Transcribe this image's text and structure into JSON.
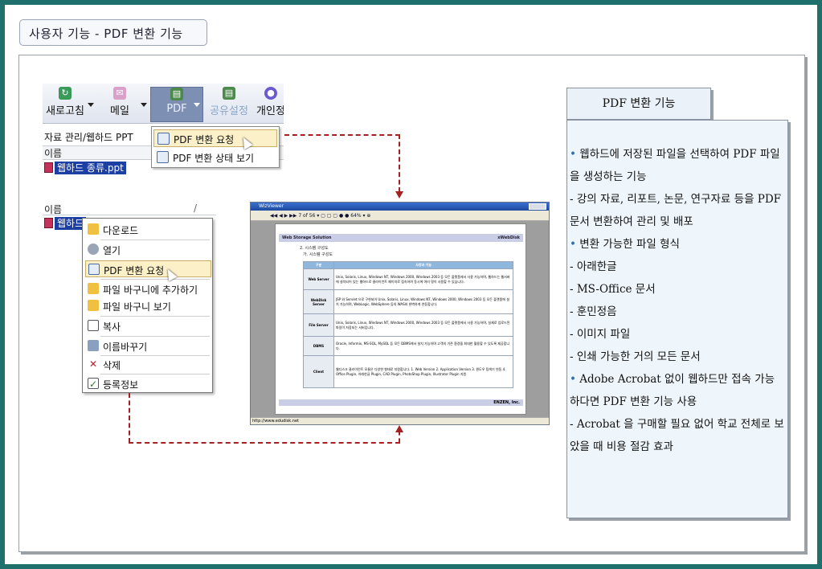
{
  "slide_title": "사용자 기능 - PDF 변환 기능",
  "toolbar": {
    "refresh": "새로고침",
    "mail": "메일",
    "pdf": "PDF",
    "share": "공유설정",
    "personal": "개인정"
  },
  "breadcrumb": "자료 관리/웹하드 PPT",
  "name_column": "이름",
  "selected_file": "웹하드 종류.ppt",
  "pdf_menu": {
    "request": "PDF 변환 요청",
    "status": "PDF 변환 상태 보기"
  },
  "list_header": "이름",
  "list_file": "웹하드",
  "context_menu": [
    "다운로드",
    "열기",
    "PDF 변환 요청",
    "파일 바구니에 추가하기",
    "파일 바구니 보기",
    "복사",
    "이름바꾸기",
    "삭제",
    "등록정보"
  ],
  "viewer": {
    "title": "WizViewer",
    "page_indicator": "7 of 56",
    "zoom": "64%",
    "doc_header_left": "Web Storage Solution",
    "doc_header_right": "xWebDisk",
    "section": "2. 시스템 구성도",
    "subsection": "가. 시스템 구성도",
    "col_left": "구분",
    "col_right": "사양과 기능",
    "rows": [
      {
        "k": "Web Server",
        "v": "Unix, Solaris, Linux, Windows NT, Windows 2000, Windows 2003 등 모든 플랫폼에서 사용 가능하며, 웹하드는 웹서버에 설치되어 있는 웹하드로 클라이언트 페이지로 접속하여 동시에 여러 명이 사용할 수 있습니다."
      },
      {
        "k": "WebDisk Server",
        "v": "JSP 와 Servlet 으로 구현되어 Unix, Solaris, Linux, Windows NT, Windows 2000, Windows 2003 등 모든 플랫폼에 설치 가능하며, WebLogic, WebSphere 등의 WAS와 완벽하게 연동합니다."
      },
      {
        "k": "File Server",
        "v": "Unix, Solaris, Linux, Windows NT, Windows 2000, Windows 2003 등 모든 플랫폼에서 사용 가능하며, 실제로 업로드된 파일이 저장되는 서버입니다."
      },
      {
        "k": "DBMS",
        "v": "Oracle, Informix, MS-SQL, MySQL 등 모든 DBMS에서 설치 가능하며 고객의 기존 환경을 최대한 활용할 수 있도록 제공합니다."
      },
      {
        "k": "Client",
        "v": "웹디스크 클라이언트 모듈은 다양한 형태로 지원합니다. 1. Web Version 2. Application Version 3. 윈도우 탐색기 연동 4. Office Plugin, 아래한글 Plugin, CAD Plugin, PhotoShop Plugin, Illustrator Plugin 지원"
      }
    ],
    "doc_footer": "ENZEN, Inc.",
    "status_url": "http://www.edudisk.net"
  },
  "info": {
    "title": "PDF 변환 기능",
    "lines": [
      {
        "bullet": "•",
        "text": " 웹하드에 저장된 파일을 선택하여 PDF 파일을 생성하는 기능"
      },
      {
        "bullet": "",
        "text": "  - 강의 자료, 리포트, 논문, 연구자료 등을 PDF 문서 변환하여 관리 및 배포"
      },
      {
        "bullet": "•",
        "text": " 변환 가능한 파일 형식"
      },
      {
        "bullet": "",
        "text": "  - 아래한글"
      },
      {
        "bullet": "",
        "text": "  - MS-Office 문서"
      },
      {
        "bullet": "",
        "text": "  - 훈민정음"
      },
      {
        "bullet": "",
        "text": "  - 이미지 파일"
      },
      {
        "bullet": "",
        "text": "  - 인쇄 가능한 거의 모든 문서"
      },
      {
        "bullet": "•",
        "text": " Adobe Acrobat 없이 웹하드만 접속 가능하다면 PDF 변환 기능 사용"
      },
      {
        "bullet": "",
        "text": "  - Acrobat 을 구매할 필요 없어 학교 전체로 보았을 때 비용 절감 효과"
      }
    ]
  },
  "colors": {
    "border_teal": "#1f6f6c",
    "dash": "#a52020",
    "panel_bg": "#eef5fb",
    "selection": "#1c3fa3",
    "highlight": "#fbf0c8"
  }
}
